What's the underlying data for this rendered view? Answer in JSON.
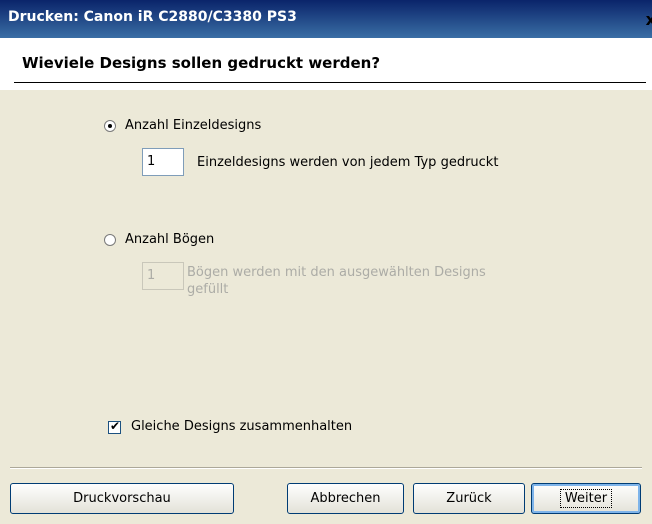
{
  "window": {
    "title": "Drucken: Canon iR C2880/C3380 PS3",
    "close_glyph": "x"
  },
  "header": {
    "question": "Wieviele Designs sollen gedruckt werden?"
  },
  "options": {
    "single": {
      "label": "Anzahl Einzeldesigns",
      "selected": true,
      "count": "1",
      "description": "Einzeldesigns werden von jedem Typ gedruckt"
    },
    "sheets": {
      "label": "Anzahl Bögen",
      "selected": false,
      "count": "1",
      "description_line1": "Bögen werden mit den ausgewählten Designs",
      "description_line2": "gefüllt"
    }
  },
  "keep_together": {
    "label": "Gleiche Designs zusammenhalten",
    "checked": true
  },
  "buttons": {
    "preview": "Druckvorschau",
    "cancel": "Abbrechen",
    "back": "Zurück",
    "next": "Weiter"
  },
  "colors": {
    "titlebar": "#0a246a",
    "dialog_bg": "#ece9d8",
    "disabled_text": "#acaca6"
  }
}
